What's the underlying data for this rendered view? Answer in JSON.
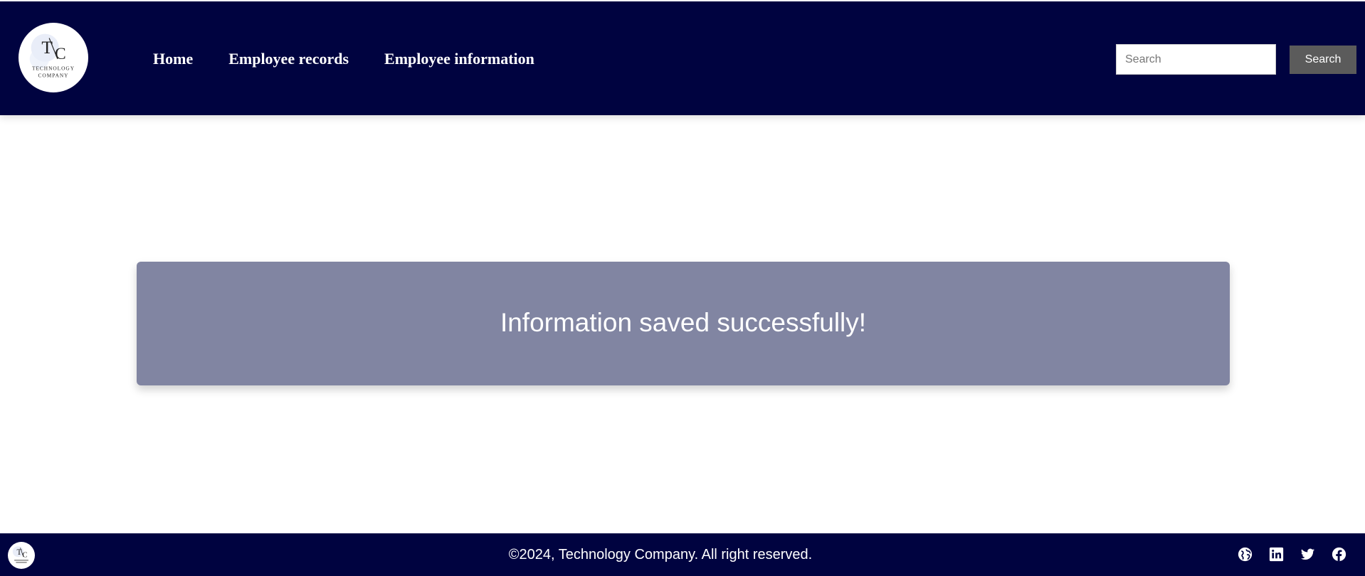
{
  "header": {
    "logo": {
      "monogram": "T/C",
      "text_line1": "TECHNOLOGY",
      "text_line2": "COMPANY"
    },
    "nav": [
      {
        "label": "Home"
      },
      {
        "label": "Employee records"
      },
      {
        "label": "Employee information"
      }
    ],
    "search": {
      "placeholder": "Search",
      "value": "",
      "button_label": "Search"
    }
  },
  "main": {
    "alert_message": "Information saved successfully!"
  },
  "footer": {
    "copyright": "©2024, Technology Company. All right reserved.",
    "social_icons": [
      "globe-icon",
      "linkedin-icon",
      "twitter-icon",
      "facebook-icon"
    ]
  },
  "colors": {
    "header_bg": "#000340",
    "alert_bg": "#8185a2",
    "search_button_bg": "#5b5b5b",
    "text_light": "#ffffff"
  }
}
